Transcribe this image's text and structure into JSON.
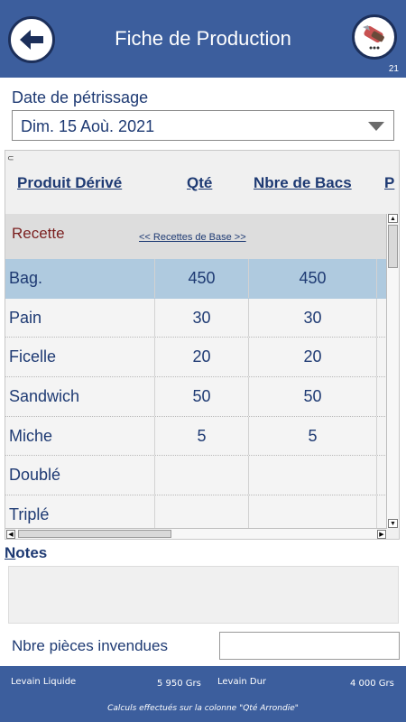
{
  "header": {
    "title": "Fiche de Production",
    "recipe_count": "21"
  },
  "date": {
    "label": "Date de pétrissage",
    "value": "Dim. 15 Aoù. 2021"
  },
  "table": {
    "columns": [
      "Produit Dérivé",
      "Qté",
      "Nbre de Bacs",
      "P"
    ],
    "section_label": "Recette",
    "base_link": "<< Recettes de Base >>",
    "rows": [
      {
        "name": "Bag.",
        "qty": "450",
        "bacs": "450",
        "selected": true
      },
      {
        "name": "Pain",
        "qty": "30",
        "bacs": "30"
      },
      {
        "name": "Ficelle",
        "qty": "20",
        "bacs": "20"
      },
      {
        "name": "Sandwich",
        "qty": "50",
        "bacs": "50"
      },
      {
        "name": "Miche",
        "qty": "5",
        "bacs": "5"
      },
      {
        "name": "Doublé",
        "qty": "",
        "bacs": ""
      },
      {
        "name": "Triplé",
        "qty": "",
        "bacs": ""
      }
    ]
  },
  "notes": {
    "label_first": "N",
    "label_rest": "otes",
    "value": ""
  },
  "unsold": {
    "label": "Nbre pièces invendues",
    "value": ""
  },
  "footer": {
    "levain_liquide_label": "Levain Liquide",
    "levain_liquide_value": "5 950 Grs",
    "levain_dur_label": "Levain Dur",
    "levain_dur_value": "4 000 Grs",
    "note": "Calculs effectués sur la colonne \"Qté Arrondie\""
  },
  "colors": {
    "header_bg": "#3c5e9d",
    "text_blue": "#1e3a73",
    "selected_row": "#afcadf",
    "recette_red": "#7a1f1f"
  },
  "icons": {
    "back": "arrow-left-icon",
    "recipes": "bread-knife-icon"
  }
}
